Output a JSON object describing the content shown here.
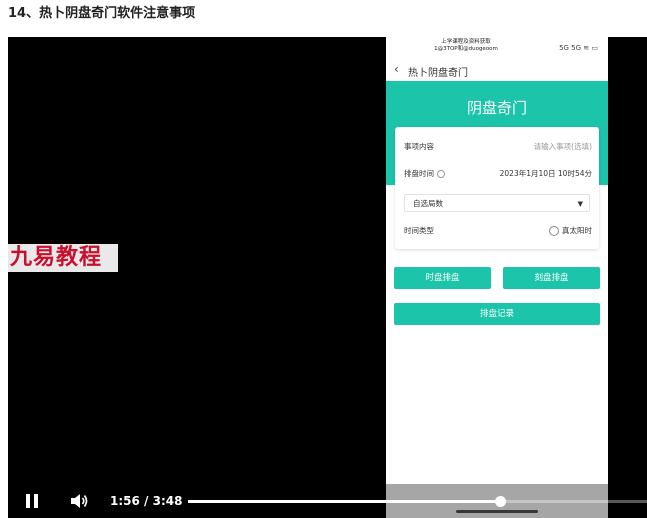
{
  "heading": "14、热卜阴盘奇门软件注意事项",
  "watermark": "九易教程",
  "phone": {
    "status_center_line1": "上学课程及资料获取",
    "status_center_line2": "1@3TOP和@duogeoom",
    "status_right": "5G 5G ≋ ▭",
    "nav_title": "热卜阴盘奇门",
    "hero_title": "阴盘奇门",
    "form": {
      "matter_label": "事项内容",
      "matter_placeholder": "请输入事项(选填)",
      "time_label": "排盘时间",
      "time_value": "2023年1月10日 10时54分",
      "select_value": "自选局数",
      "timetype_label": "时间类型",
      "timetype_option": "真太阳时"
    },
    "buttons": {
      "hour_plate": "时盘排盘",
      "quarter_plate": "刻盘排盘",
      "records": "排盘记录"
    }
  },
  "player": {
    "current_time": "1:56",
    "separator": "/",
    "duration": "3:48",
    "progress": 0.68
  }
}
